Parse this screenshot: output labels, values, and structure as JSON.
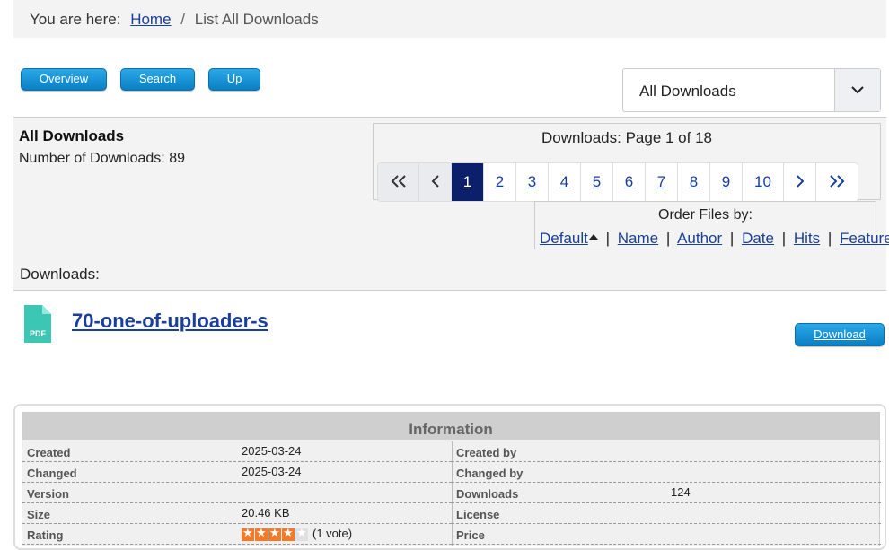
{
  "breadcrumb": {
    "prefix": "You are here:",
    "home": "Home",
    "separator": "/",
    "current": "List All Downloads"
  },
  "nav_buttons": {
    "overview": "Overview",
    "search": "Search",
    "up": "Up"
  },
  "category_select": {
    "selected": "All Downloads"
  },
  "category": {
    "title": "All Downloads",
    "count_label": "Number of Downloads: 89",
    "downloads_label": "Downloads:"
  },
  "pagination": {
    "title": "Downloads: Page 1 of 18",
    "first": "«",
    "prev": "‹",
    "pages": [
      "1",
      "2",
      "3",
      "4",
      "5",
      "6",
      "7",
      "8",
      "9",
      "10"
    ],
    "active_page": "1",
    "next": "›",
    "last": "»"
  },
  "ordering": {
    "title": "Order Files by:",
    "options": [
      "Default",
      "Name",
      "Author",
      "Date",
      "Hits",
      "Featured"
    ],
    "separator": "|"
  },
  "file": {
    "icon": "pdf-file-icon",
    "icon_label": "PDF",
    "icon_color": "#3cc7b4",
    "title": "70-one-of-uploader-s",
    "download_button": "Download"
  },
  "info": {
    "heading": "Information",
    "left": [
      {
        "key": "Created",
        "value": "2025-03-24"
      },
      {
        "key": "Changed",
        "value": "2025-03-24"
      },
      {
        "key": "Version",
        "value": ""
      },
      {
        "key": "Size",
        "value": "20.46 KB"
      },
      {
        "key": "Rating",
        "value": "(1 vote)"
      }
    ],
    "right": [
      {
        "key": "Created by",
        "value": ""
      },
      {
        "key": "Changed by",
        "value": ""
      },
      {
        "key": "Downloads",
        "value": "124"
      },
      {
        "key": "License",
        "value": ""
      },
      {
        "key": "Price",
        "value": ""
      }
    ],
    "rating_stars": 4,
    "rating_max": 5
  },
  "colors": {
    "button_blue": "#0a7fc4",
    "active_page": "#0c1f6a",
    "link": "#1a3f9a",
    "star": "#f47a2a"
  }
}
